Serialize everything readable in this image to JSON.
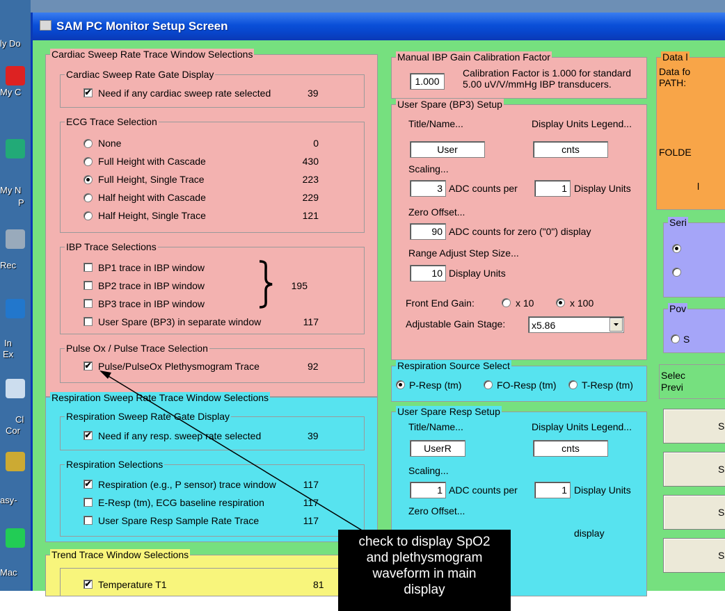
{
  "window": {
    "title": "SAM PC Monitor Setup Screen"
  },
  "desktop": {
    "labels": [
      "ly Do",
      "My C",
      "My N",
      "P",
      "Rec",
      "In",
      "Ex",
      "Cl",
      "Cor",
      "asy-",
      "Mac"
    ]
  },
  "cardiac": {
    "legend": "Cardiac Sweep Rate Trace Window Selections",
    "gate": {
      "legend": "Cardiac Sweep Rate Gate Display",
      "label": "Need if any cardiac sweep rate selected",
      "value": "39",
      "checked": true
    },
    "ecg": {
      "legend": "ECG Trace Selection",
      "options": [
        {
          "label": "None",
          "value": "0",
          "selected": false
        },
        {
          "label": "Full Height with Cascade",
          "value": "430",
          "selected": false
        },
        {
          "label": "Full Height, Single Trace",
          "value": "223",
          "selected": true
        },
        {
          "label": "Half height with Cascade",
          "value": "229",
          "selected": false
        },
        {
          "label": "Half Height, Single Trace",
          "value": "121",
          "selected": false
        }
      ]
    },
    "ibp": {
      "legend": "IBP Trace Selections",
      "items": [
        {
          "label": "BP1 trace in IBP window",
          "checked": false
        },
        {
          "label": "BP2 trace in IBP window",
          "checked": false
        },
        {
          "label": "BP3 trace in IBP window",
          "checked": false
        },
        {
          "label": "User Spare (BP3) in separate window",
          "checked": false
        }
      ],
      "group_value": "195",
      "spare_value": "117"
    },
    "pulse": {
      "legend": "Pulse Ox / Pulse Trace Selection",
      "label": "Pulse/PulseOx Plethysmogram Trace",
      "value": "92",
      "checked": true
    }
  },
  "respiration": {
    "legend": "Respiration Sweep Rate Trace Window Selections",
    "gate": {
      "legend": "Respiration Sweep Rate Gate Display",
      "label": "Need if any resp. sweep rate selected",
      "value": "39",
      "checked": true
    },
    "selections": {
      "legend": "Respiration Selections",
      "items": [
        {
          "label": "Respiration (e.g., P sensor) trace window",
          "value": "117",
          "checked": true
        },
        {
          "label": "E-Resp (tm), ECG baseline respiration",
          "value": "117",
          "checked": false
        },
        {
          "label": "User Spare Resp Sample Rate Trace",
          "value": "117",
          "checked": false
        }
      ]
    }
  },
  "trend": {
    "legend": "Trend Trace Window Selections",
    "label": "Temperature T1",
    "value": "81",
    "checked": true
  },
  "ibp_gain": {
    "legend": "Manual IBP Gain Calibration Factor",
    "value": "1.000",
    "note1": "Calibration Factor is 1.000 for standard",
    "note2": "5.00 uV/V/mmHg IBP transducers."
  },
  "bp3": {
    "legend": "User Spare (BP3) Setup",
    "title_label": "Title/Name...",
    "units_label": "Display Units Legend...",
    "title_value": "User",
    "units_value": "cnts",
    "scaling_label": "Scaling...",
    "adc_value": "3",
    "adc_per": "ADC counts per",
    "disp_value": "1",
    "disp_units": "Display Units",
    "zero_label": "Zero Offset...",
    "zero_value": "90",
    "zero_text": "ADC counts for zero (\"0\") display",
    "range_label": "Range Adjust Step Size...",
    "range_value": "10",
    "range_units": "Display Units",
    "gain_label": "Front End Gain:",
    "gain_x10": "x 10",
    "gain_x100": "x 100",
    "adj_label": "Adjustable Gain Stage:",
    "adj_value": "x5.86"
  },
  "resp_source": {
    "legend": "Respiration Source Select",
    "opt1": "P-Resp (tm)",
    "opt2": "FO-Resp (tm)",
    "opt3": "T-Resp (tm)"
  },
  "resp_spare": {
    "legend": "User Spare Resp Setup",
    "title_label": "Title/Name...",
    "units_label": "Display Units Legend...",
    "title_value": "UserR",
    "units_value": "cnts",
    "scaling_label": "Scaling...",
    "adc_value": "1",
    "adc_per": "ADC counts per",
    "disp_value": "1",
    "disp_units": "Display Units",
    "zero_label": "Zero Offset...",
    "zero_partial": "display"
  },
  "right": {
    "data_legend": "Data l",
    "data_line1": "Data fo",
    "data_line2": "PATH:",
    "folder": "FOLDE",
    "folder_end": "l",
    "ser_legend": "Seri",
    "pow_legend": "Pov",
    "pow_opt": "S",
    "select_label": "Selec",
    "previ_label": "Previ",
    "btn_label": "S"
  },
  "callout": {
    "line1": "check to display  SpO2",
    "line2": "and plethysmogram",
    "line3": "waveform  in main",
    "line4": "display"
  },
  "colors": {
    "window_bg": "#76e07f",
    "pink": "#f3b2b0",
    "cyan": "#57e3ef",
    "yellow": "#f8f57c",
    "orange": "#f8a548",
    "lavender": "#a5a5f8",
    "titlebar": "#0a4fd8"
  }
}
